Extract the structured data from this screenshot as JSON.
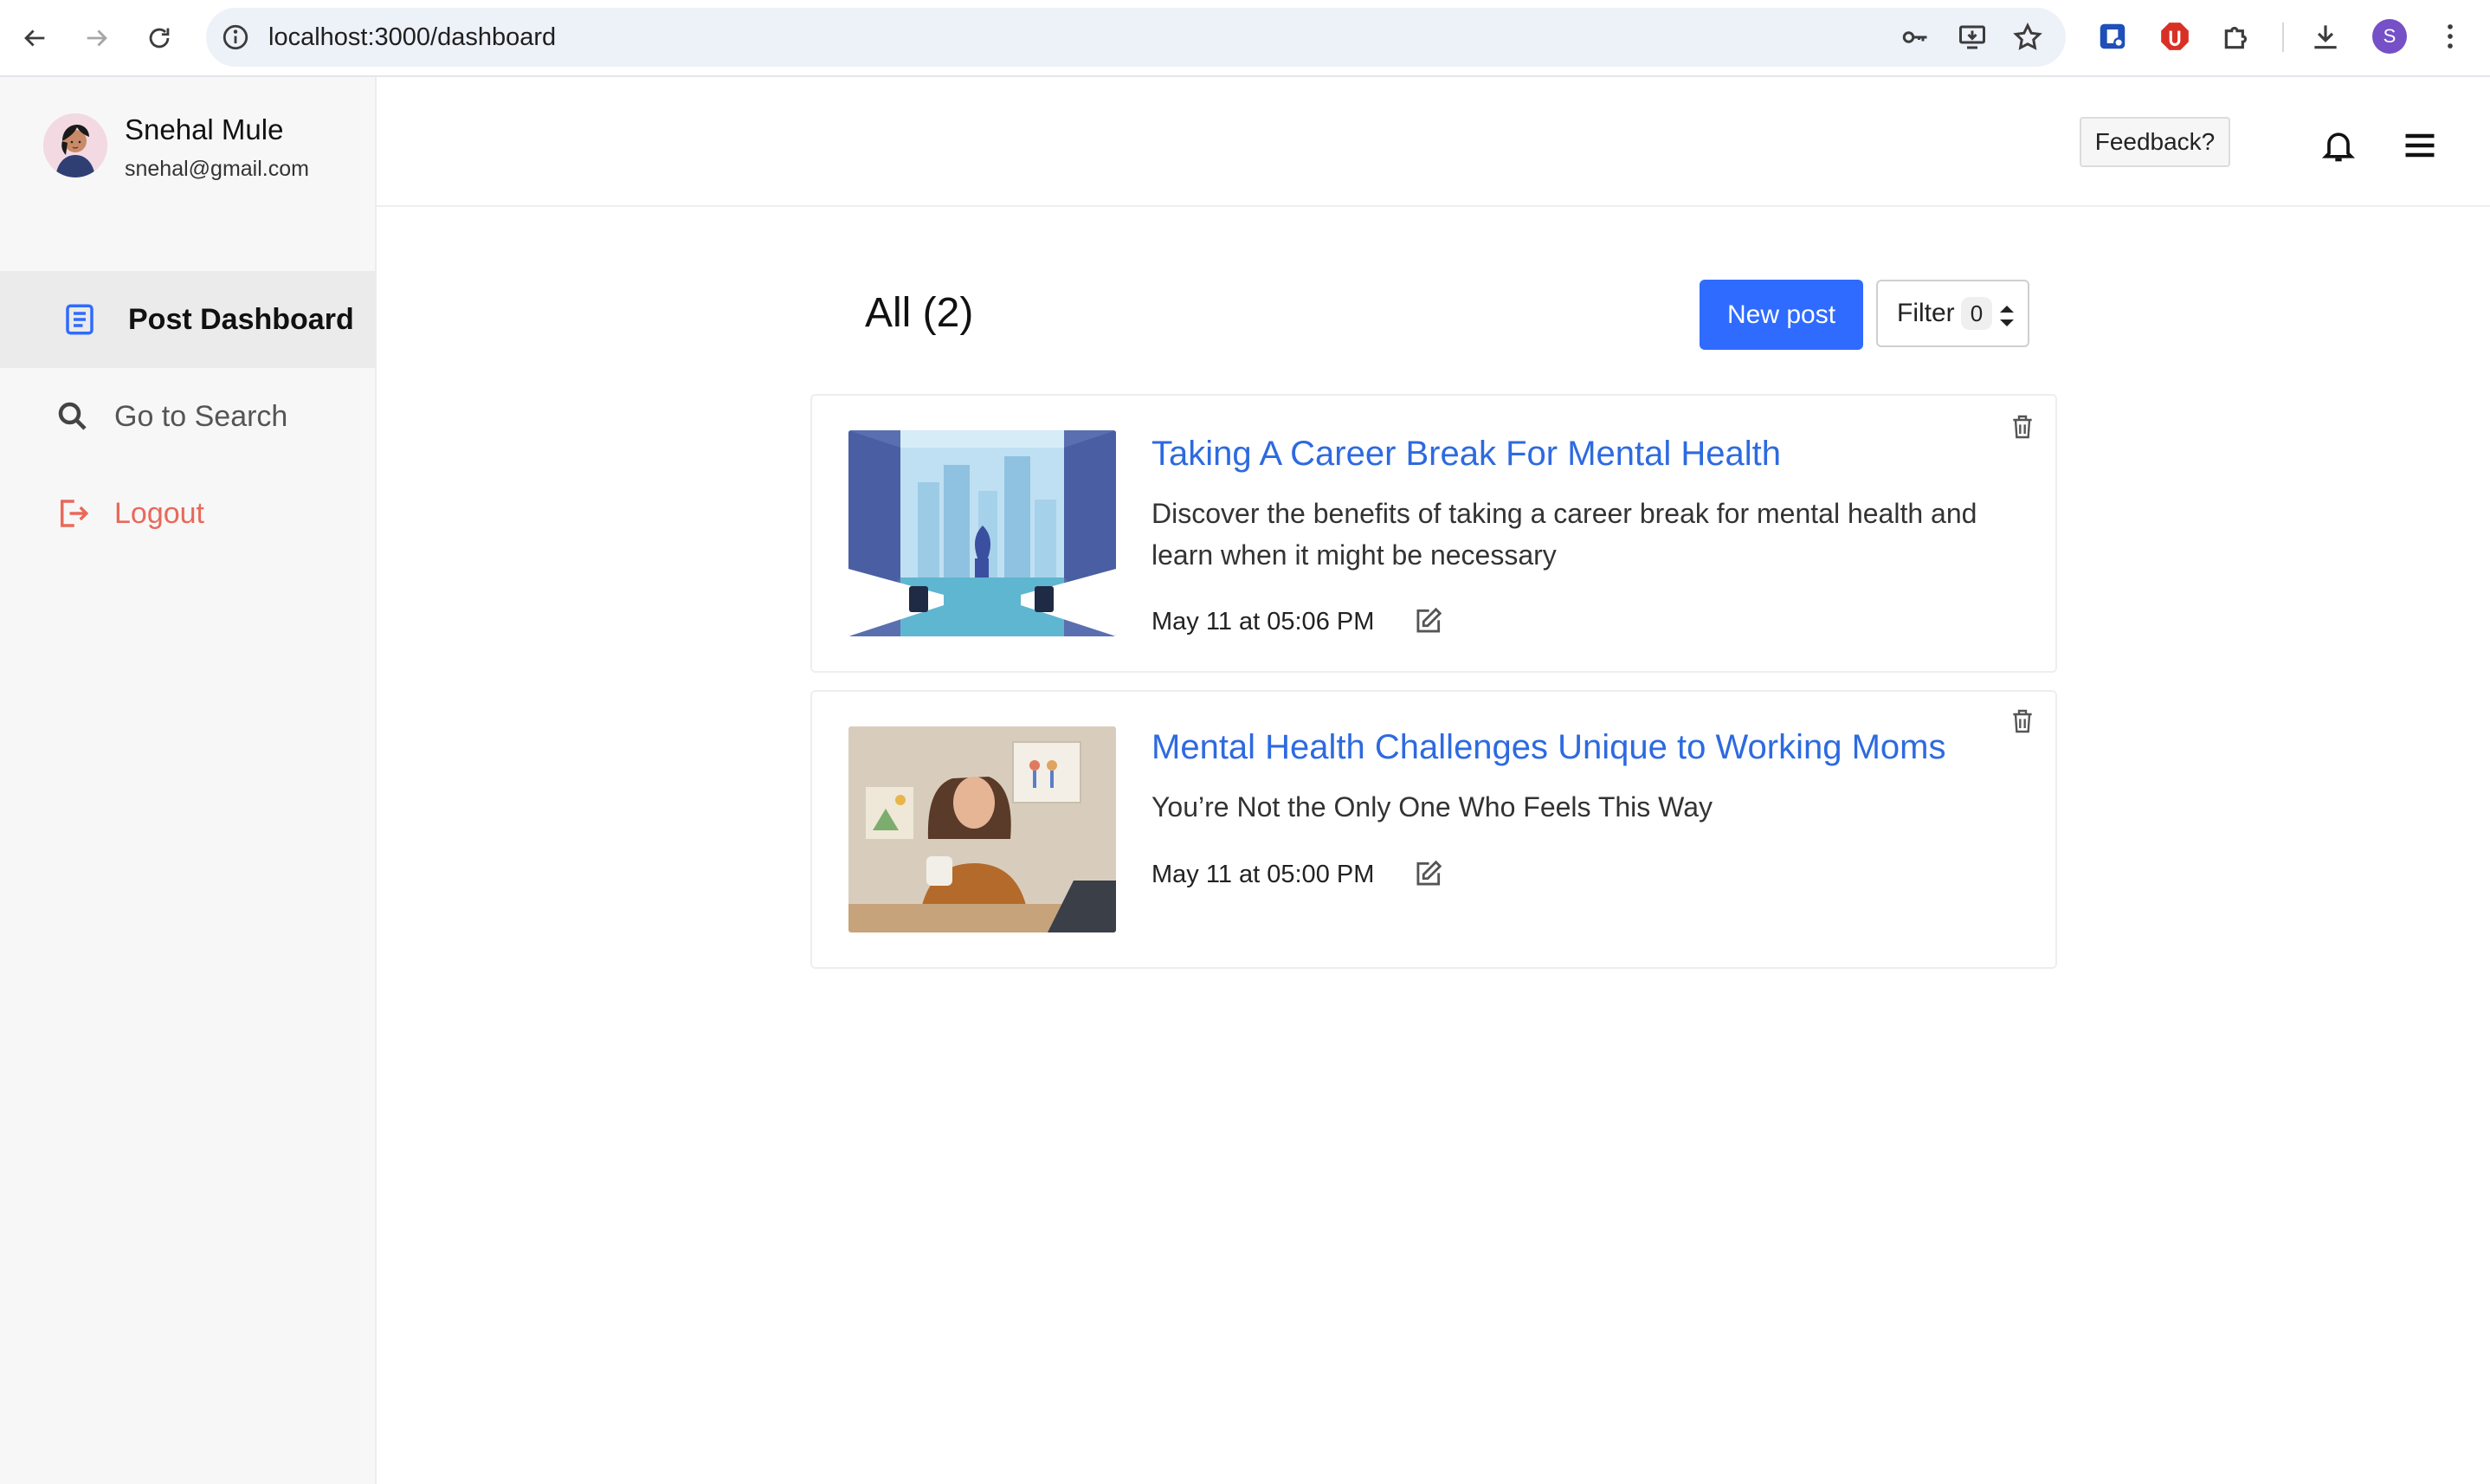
{
  "browser": {
    "url": "localhost:3000/dashboard",
    "profile_initial": "S"
  },
  "sidebar": {
    "user_name": "Snehal Mule",
    "user_email": "snehal@gmail.com",
    "items": [
      {
        "label": "Post Dashboard",
        "icon": "document-icon",
        "active": true
      },
      {
        "label": "Go to Search",
        "icon": "search-icon",
        "active": false
      },
      {
        "label": "Logout",
        "icon": "logout-icon",
        "active": false
      }
    ]
  },
  "topbar": {
    "feedback_label": "Feedback?"
  },
  "main": {
    "section_title": "All (2)",
    "new_post_label": "New post",
    "filter_label": "Filter",
    "filter_count": "0",
    "posts": [
      {
        "title": "Taking A Career Break For Mental Health",
        "description": "Discover the benefits of taking a career break for mental health and learn when it might be necessary",
        "date": "May 11 at 05:06 PM"
      },
      {
        "title": "Mental Health Challenges Unique to Working Moms",
        "description": "You’re Not the Only One Who Feels This Way",
        "date": "May 11 at 05:00 PM"
      }
    ]
  },
  "colors": {
    "accent": "#2f6bff",
    "link": "#2d6ae0",
    "logout": "#e8695a",
    "sidebar_active": "#ebebeb"
  }
}
